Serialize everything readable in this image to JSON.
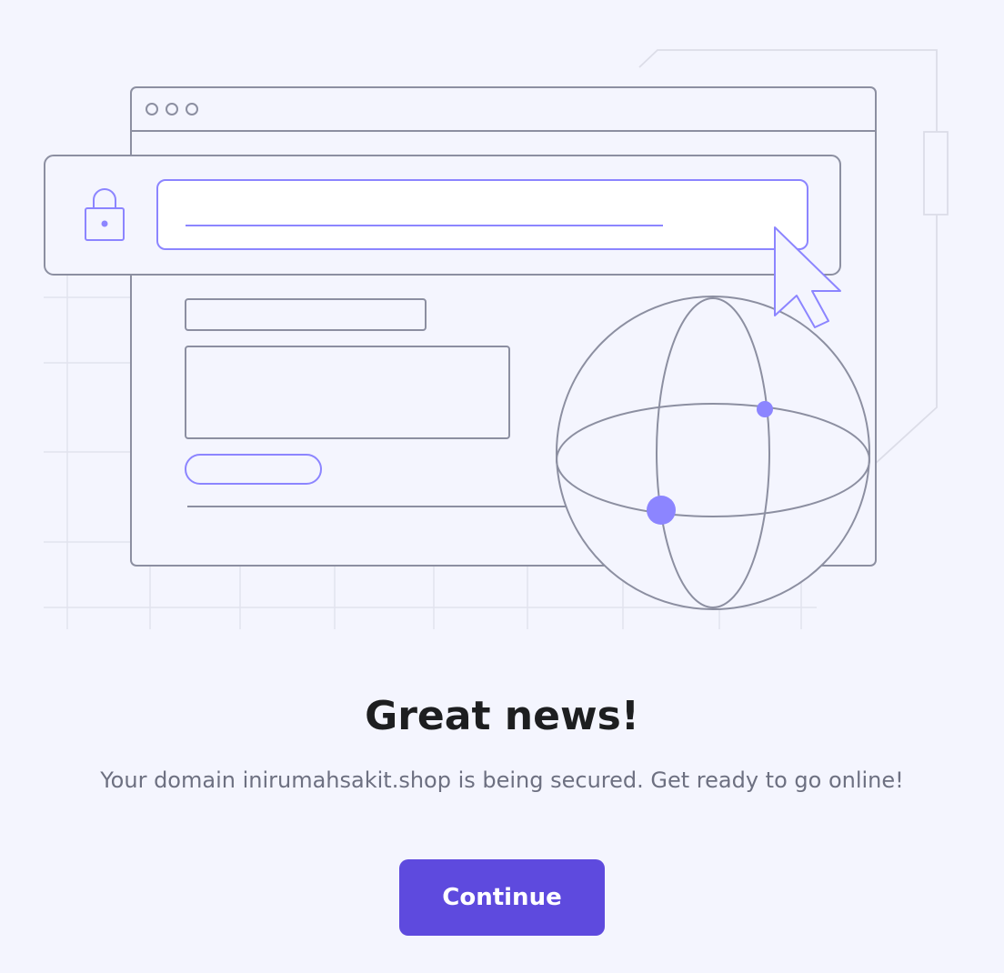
{
  "illustration": {
    "icons": [
      "lock-icon",
      "cursor-icon",
      "globe-icon"
    ],
    "colors": {
      "background": "#f4f5fe",
      "line": "#8c8fa1",
      "accent": "#8c85ff",
      "grid": "#e2e3ee"
    }
  },
  "content": {
    "title": "Great news!",
    "message": "Your domain inirumahsakit.shop is being secured. Get ready to go online!",
    "continue_label": "Continue"
  },
  "colors": {
    "title": "#1d1e20",
    "message": "#6d7081",
    "button": "#5e4ade",
    "button_text": "#ffffff"
  }
}
